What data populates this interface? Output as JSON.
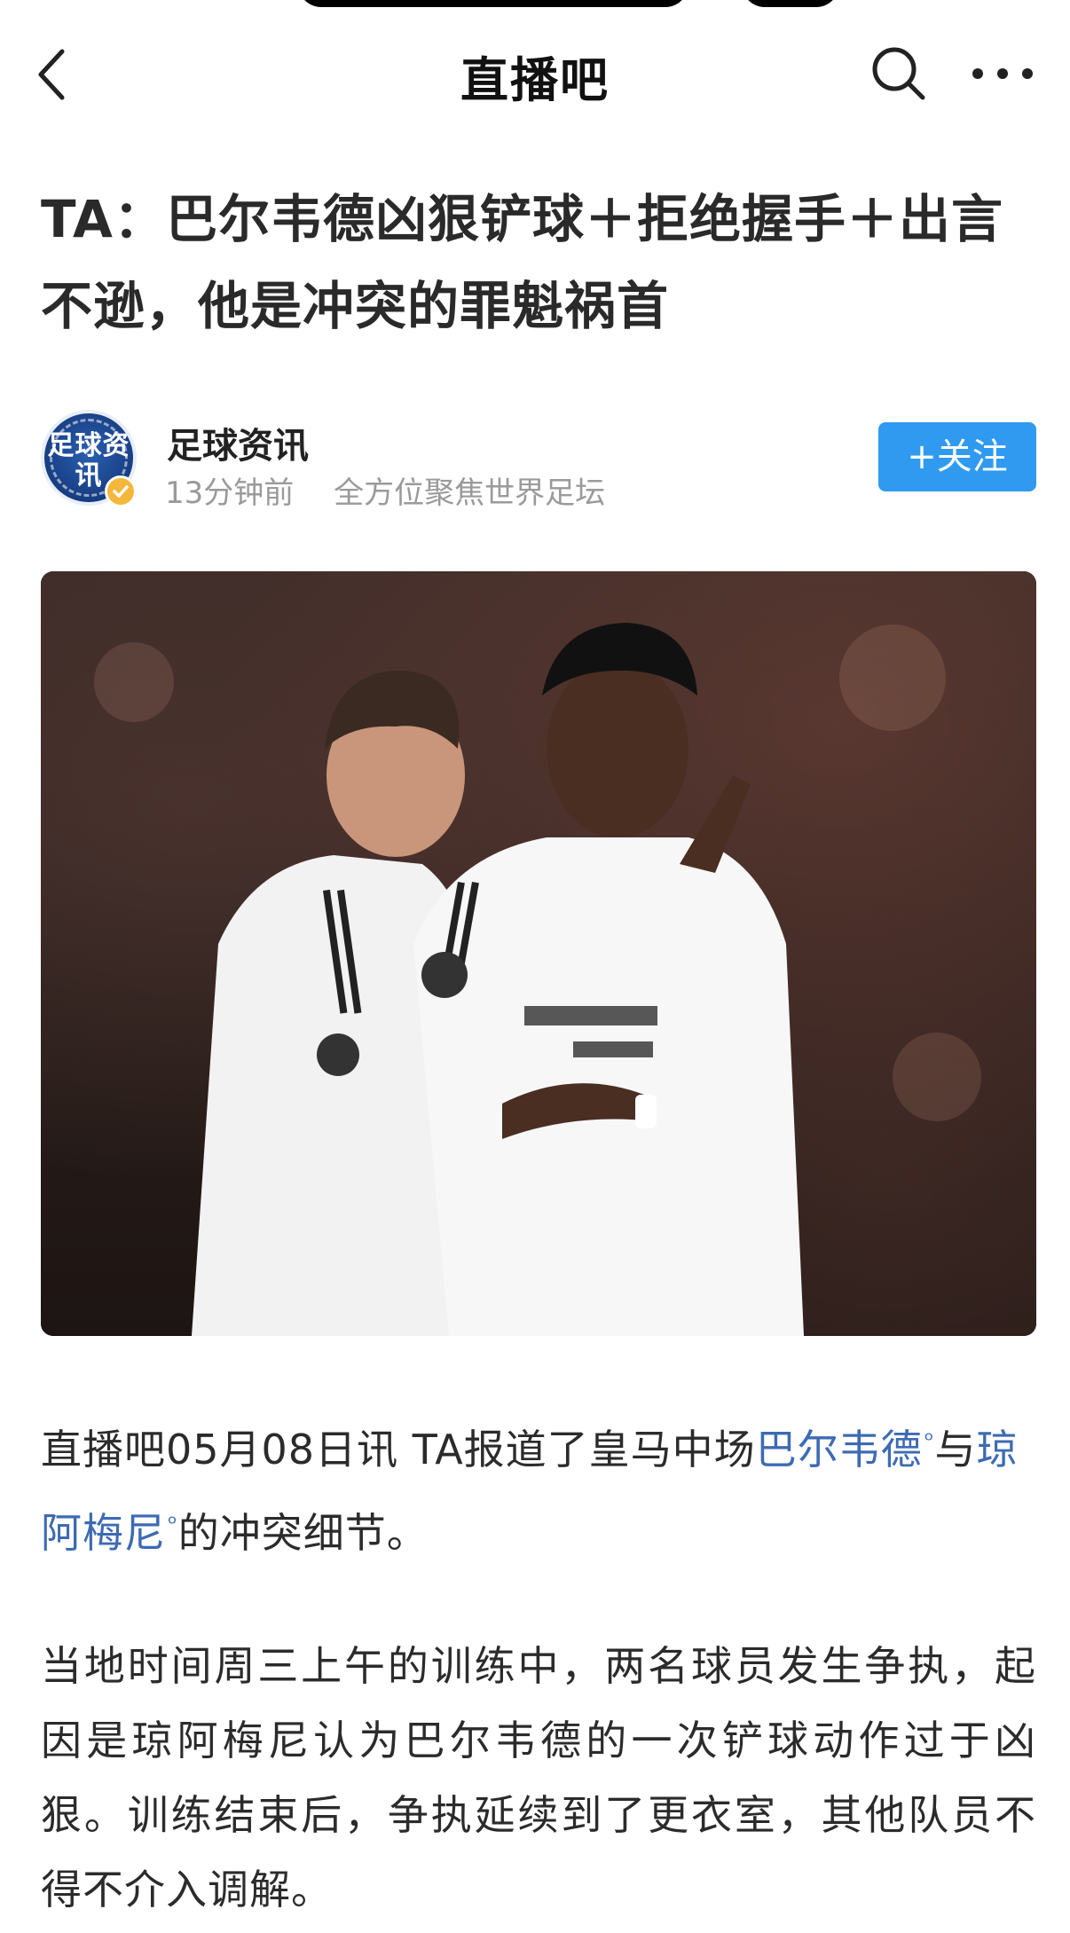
{
  "nav": {
    "title": "直播吧"
  },
  "article": {
    "title": "TA：巴尔韦德凶狠铲球＋拒绝握手＋出言不逊，他是冲突的罪魁祸首"
  },
  "author": {
    "avatar_text": "足球资讯",
    "name": "足球资讯",
    "time": "13分钟前",
    "slogan": "全方位聚焦世界足坛",
    "follow_label": "+关注"
  },
  "body": {
    "p1_prefix": "直播吧05月08日讯  TA报道了皇马中场",
    "p1_link1": "巴尔韦德",
    "p1_mid": "与",
    "p1_link2": "琼阿梅尼",
    "p1_suffix": "的冲突细节。",
    "p2": "当地时间周三上午的训练中，两名球员发生争执，起因是琼阿梅尼认为巴尔韦德的一次铲球动作过于凶狠。训练结束后，争执延续到了更衣室，其他队员不得不介入调解。"
  },
  "colors": {
    "link": "#3d6bb3",
    "follow_button": "#2f9af0",
    "verified_badge": "#f5b73b"
  }
}
